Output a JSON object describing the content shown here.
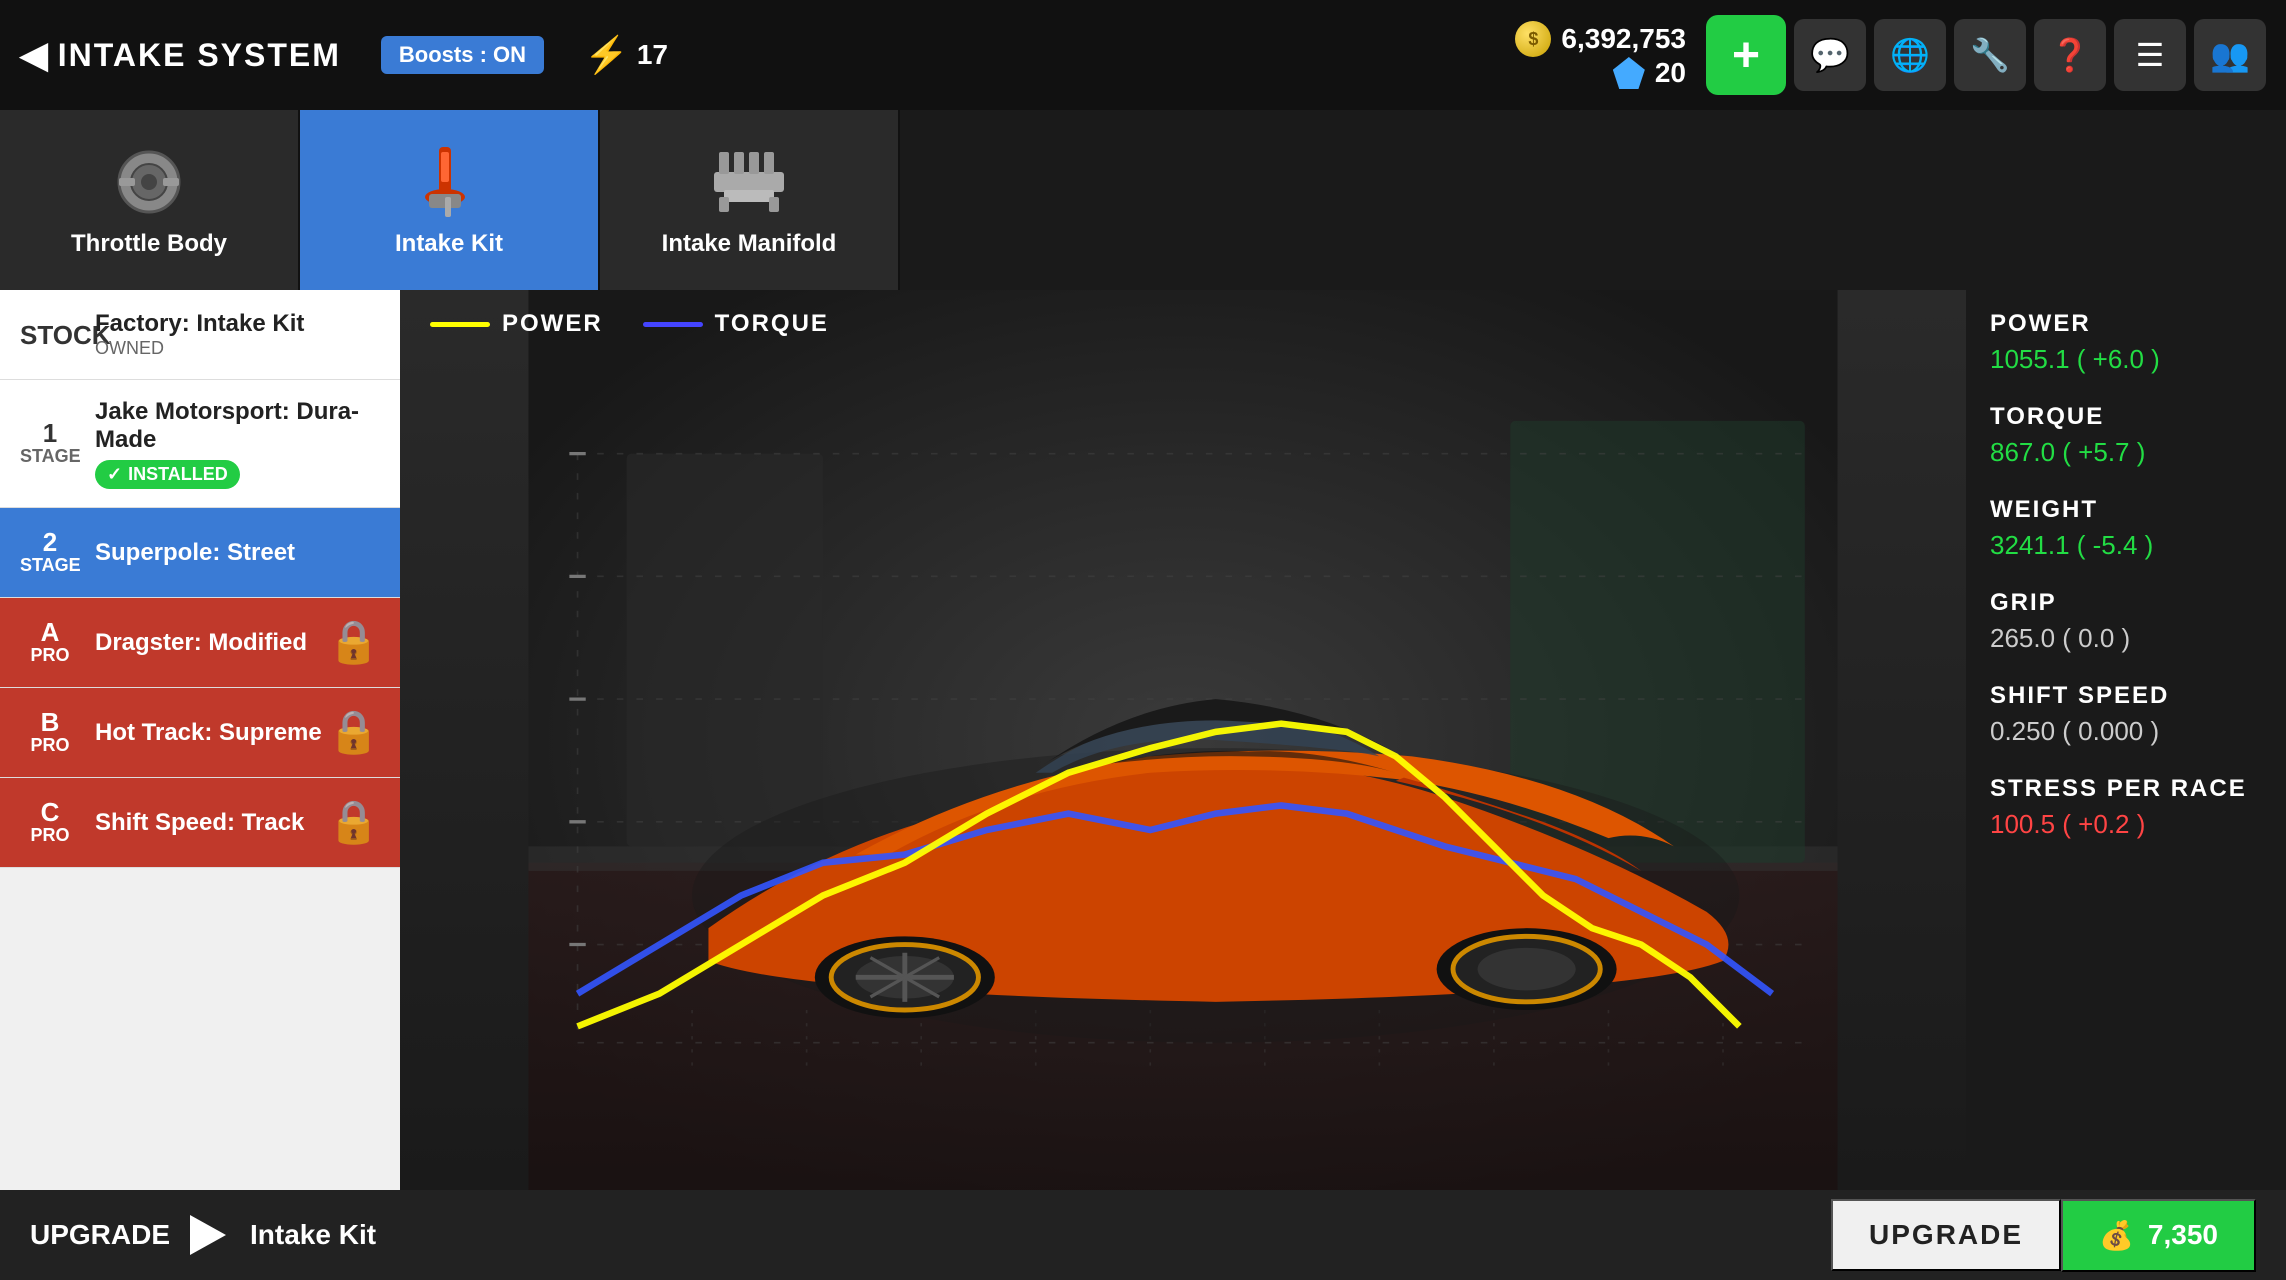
{
  "header": {
    "back_label": "INTAKE SYSTEM",
    "boost_label": "Boosts : ON",
    "lightning_count": "17",
    "coin_amount": "6,392,753",
    "gem_amount": "20",
    "add_btn_label": "+",
    "icons": [
      "💬",
      "🌐",
      "🔧",
      "❓",
      "≡≡≡",
      "👥"
    ]
  },
  "tabs": [
    {
      "id": "throttle-body",
      "label": "Throttle Body",
      "active": false
    },
    {
      "id": "intake-kit",
      "label": "Intake Kit",
      "active": true
    },
    {
      "id": "intake-manifold",
      "label": "Intake Manifold",
      "active": false
    }
  ],
  "upgrades": [
    {
      "id": "stock",
      "stage": "STOCK",
      "stage_sub": "",
      "name": "Factory: Intake Kit",
      "status": "OWNED",
      "locked": false,
      "selected": false,
      "installed": false
    },
    {
      "id": "stage1",
      "stage": "1",
      "stage_sub": "STAGE",
      "name": "Jake Motorsport: Dura-Made",
      "status": "INSTALLED",
      "locked": false,
      "selected": false,
      "installed": true
    },
    {
      "id": "stage2",
      "stage": "2",
      "stage_sub": "STAGE",
      "name": "Superpole: Street",
      "status": "",
      "locked": false,
      "selected": true,
      "installed": false
    },
    {
      "id": "stagea",
      "stage": "A",
      "stage_sub": "PRO",
      "name": "Dragster: Modified",
      "status": "",
      "locked": true,
      "selected": false,
      "installed": false
    },
    {
      "id": "stageb",
      "stage": "B",
      "stage_sub": "PRO",
      "name": "Hot Track: Supreme",
      "status": "",
      "locked": true,
      "selected": false,
      "installed": false
    },
    {
      "id": "stagec",
      "stage": "C",
      "stage_sub": "PRO",
      "name": "Shift Speed: Track",
      "status": "",
      "locked": true,
      "selected": false,
      "installed": false
    }
  ],
  "chart": {
    "power_label": "POWER",
    "torque_label": "TORQUE",
    "power_color": "#ffff00",
    "torque_color": "#4444ff"
  },
  "stats": [
    {
      "id": "power",
      "name": "POWER",
      "value": "1055.1 ( +6.0 )",
      "positive": true
    },
    {
      "id": "torque",
      "name": "TORQUE",
      "value": "867.0 ( +5.7 )",
      "positive": true
    },
    {
      "id": "weight",
      "name": "WEIGHT",
      "value": "3241.1 ( -5.4 )",
      "positive": true
    },
    {
      "id": "grip",
      "name": "GRIP",
      "value": "265.0 ( 0.0 )",
      "positive": false
    },
    {
      "id": "shift-speed",
      "name": "SHIFT SPEED",
      "value": "0.250 ( 0.000 )",
      "positive": false
    },
    {
      "id": "stress",
      "name": "STRESS PER RACE",
      "value": "100.5 ( +0.2 )",
      "positive": false,
      "negative": true
    }
  ],
  "bottom": {
    "upgrade_label": "UPGRADE",
    "item_label": "Intake Kit",
    "upgrade_btn_label": "UPGRADE",
    "cost_label": "7,350"
  }
}
